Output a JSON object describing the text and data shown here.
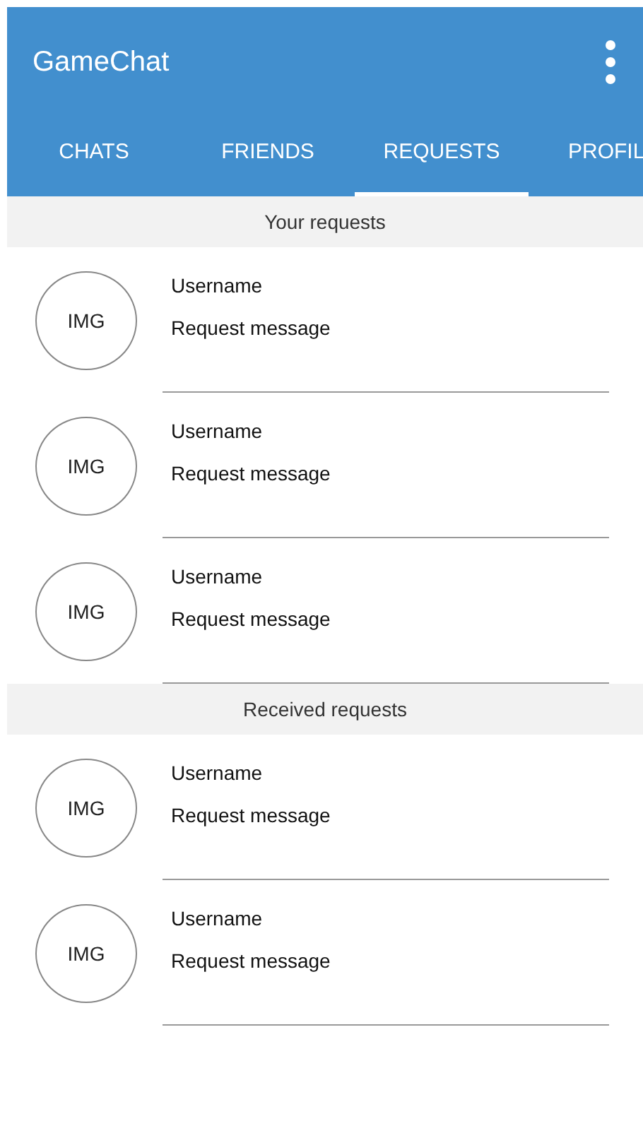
{
  "app_bar": {
    "title": "GameChat"
  },
  "tabs": [
    {
      "label": "CHATS",
      "selected": false
    },
    {
      "label": "FRIENDS",
      "selected": false
    },
    {
      "label": "REQUESTS",
      "selected": true
    },
    {
      "label": "PROFIL",
      "selected": false
    }
  ],
  "sections": [
    {
      "title": "Your requests",
      "items": [
        {
          "avatar": "IMG",
          "username": "Username",
          "message": "Request message"
        },
        {
          "avatar": "IMG",
          "username": "Username",
          "message": "Request message"
        },
        {
          "avatar": "IMG",
          "username": "Username",
          "message": "Request message"
        }
      ]
    },
    {
      "title": "Received requests",
      "items": [
        {
          "avatar": "IMG",
          "username": "Username",
          "message": "Request message"
        },
        {
          "avatar": "IMG",
          "username": "Username",
          "message": "Request message"
        }
      ]
    }
  ]
}
